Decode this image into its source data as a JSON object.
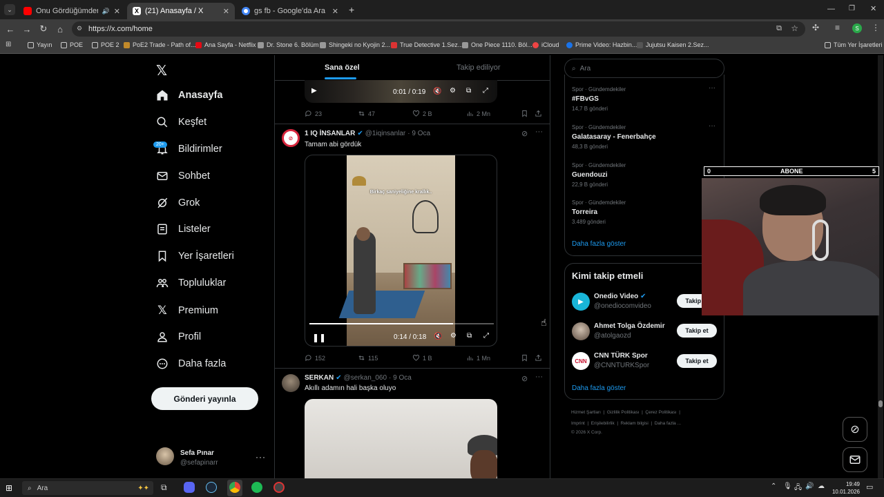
{
  "browser": {
    "tabs": [
      {
        "title": "Onu Gördüğümden Beri - Y",
        "favicon_color": "#ff0000"
      },
      {
        "title": "(21) Anasayfa / X",
        "favicon_color": "#000000"
      },
      {
        "title": "gs fb - Google'da Ara",
        "favicon_color": "#4285f4"
      }
    ],
    "url": "https://x.com/home",
    "bookmarks": [
      "Yayın",
      "POE",
      "POE 2",
      "PoE2 Trade - Path of...",
      "Ana Sayfa - Netflix",
      "Dr. Stone 6. Bölüm",
      "Shingeki no Kyojin 2...",
      "True Detective 1.Sez...",
      "One Piece 1110. Böl...",
      "iCloud",
      "Prime Video: Hazbin...",
      "Jujutsu Kaisen 2.Sez..."
    ],
    "all_bookmarks": "Tüm Yer İşaretleri",
    "profile_initial": "S"
  },
  "nav": {
    "items": [
      "Anasayfa",
      "Keşfet",
      "Bildirimler",
      "Sohbet",
      "Grok",
      "Listeler",
      "Yer İşaretleri",
      "Topluluklar",
      "Premium",
      "Profil",
      "Daha fazla"
    ],
    "badge": "20+",
    "post_button": "Gönderi yayınla",
    "user": {
      "name": "Sefa Pınar",
      "handle": "@sefapinarr"
    }
  },
  "feed": {
    "tabs": [
      "Sana özel",
      "Takip ediliyor"
    ],
    "top_video_time": "0:01 / 0:19",
    "top_actions": {
      "reply": "23",
      "repost": "47",
      "like": "2 B",
      "views": "2 Mn"
    },
    "tweets": [
      {
        "name": "1 IQ İNSANLAR",
        "handle": "@1iqinsanlar",
        "date": "· 9 Oca",
        "text": "Tamam abi gördük",
        "video_caption": "Birkaç saniyeliğine krallık..",
        "video_time": "0:14 / 0:18",
        "video_progress": 0.78,
        "actions": {
          "reply": "152",
          "repost": "115",
          "like": "1 B",
          "views": "1 Mn"
        }
      },
      {
        "name": "SERKAN",
        "handle": "@serkan_060",
        "date": "· 9 Oca",
        "text": "Akıllı adamın hali başka oluyo"
      }
    ]
  },
  "search": {
    "placeholder": "Ara"
  },
  "trends": [
    {
      "category": "Spor · Gündemdekiler",
      "name": "#FBvGS",
      "count": "14,7 B gönderi"
    },
    {
      "category": "Spor · Gündemdekiler",
      "name": "Galatasaray - Fenerbahçe",
      "count": "48,3 B gönderi"
    },
    {
      "category": "Spor · Gündemdekiler",
      "name": "Guendouzi",
      "count": "22,9 B gönderi"
    },
    {
      "category": "Spor · Gündemdekiler",
      "name": "Torreira",
      "count": "3.489 gönderi"
    }
  ],
  "show_more": "Daha fazla göster",
  "who_to_follow": {
    "title": "Kimi takip etmeli",
    "users": [
      {
        "name": "Onedio Video",
        "handle": "@onediocomvideo",
        "button": "Takip et"
      },
      {
        "name": "Ahmet Tolga Özdemir",
        "handle": "@atolgaozd",
        "button": "Takip et"
      },
      {
        "name": "CNN TÜRK Spor",
        "handle": "@CNNTURKSpor",
        "button": "Takip et"
      }
    ]
  },
  "footer": {
    "line1": [
      "Hizmet Şartları",
      "Gizlilik Politikası",
      "Çerez Politikası"
    ],
    "line2": [
      "Imprint",
      "Erişilebilirlik",
      "Reklam bilgisi",
      "Daha fazla ..."
    ],
    "copyright": "© 2026 X Corp."
  },
  "overlay": {
    "left": "0",
    "label": "ABONE",
    "right": "5"
  },
  "taskbar": {
    "search": "Ara",
    "time": "19:49",
    "date": "10.01.2026"
  }
}
